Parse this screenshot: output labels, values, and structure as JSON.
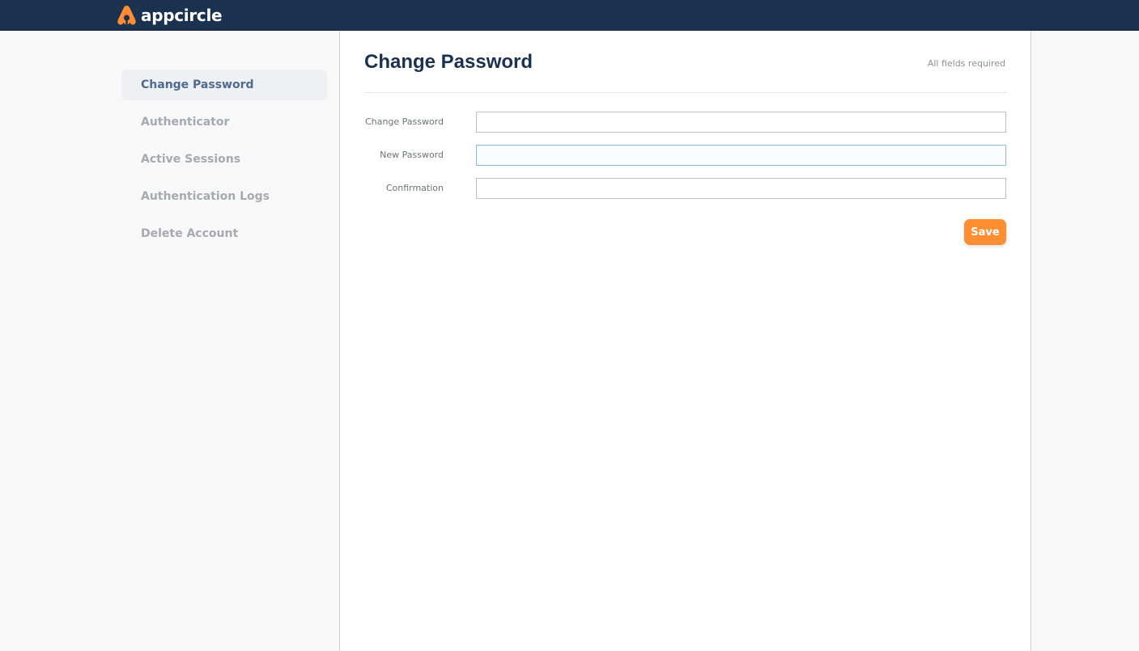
{
  "app": {
    "brand_name": "appcircle",
    "brand_color": "#ff8e32",
    "header_color": "#1b3150"
  },
  "sidebar": {
    "items": [
      {
        "label": "Change Password",
        "active": true
      },
      {
        "label": "Authenticator",
        "active": false
      },
      {
        "label": "Active Sessions",
        "active": false
      },
      {
        "label": "Authentication Logs",
        "active": false
      },
      {
        "label": "Delete Account",
        "active": false
      }
    ]
  },
  "main": {
    "title": "Change Password",
    "required_note": "All fields required",
    "fields": [
      {
        "label": "Change Password",
        "value": "",
        "type": "password"
      },
      {
        "label": "New Password",
        "value": "",
        "type": "password"
      },
      {
        "label": "Confirmation",
        "value": "",
        "type": "password"
      }
    ],
    "save_label": "Save"
  },
  "icons": {
    "logo": "appcircle-logo-icon"
  }
}
